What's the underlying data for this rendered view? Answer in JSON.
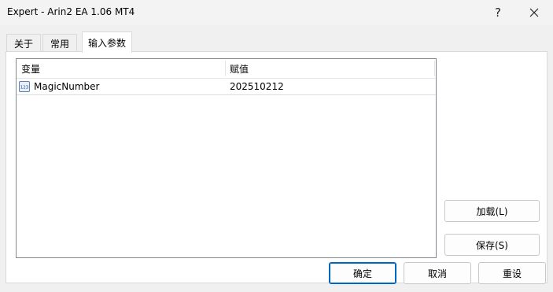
{
  "window": {
    "title": "Expert - Arin2 EA 1.06 MT4",
    "help_symbol": "?",
    "close_icon": "close-icon"
  },
  "tabs": [
    {
      "label": "关于",
      "active": false
    },
    {
      "label": "常用",
      "active": false
    },
    {
      "label": "输入参数",
      "active": true
    }
  ],
  "params_table": {
    "columns": [
      "变量",
      "赋值"
    ],
    "rows": [
      {
        "icon": "integer-param-icon",
        "icon_text": "123",
        "name": "MagicNumber",
        "value": "202510212"
      }
    ]
  },
  "side_buttons": {
    "load": "加载(L)",
    "save": "保存(S)"
  },
  "footer_buttons": {
    "ok": "确定",
    "cancel": "取消",
    "reset": "重设"
  },
  "colors": {
    "accent": "#0067c0"
  }
}
